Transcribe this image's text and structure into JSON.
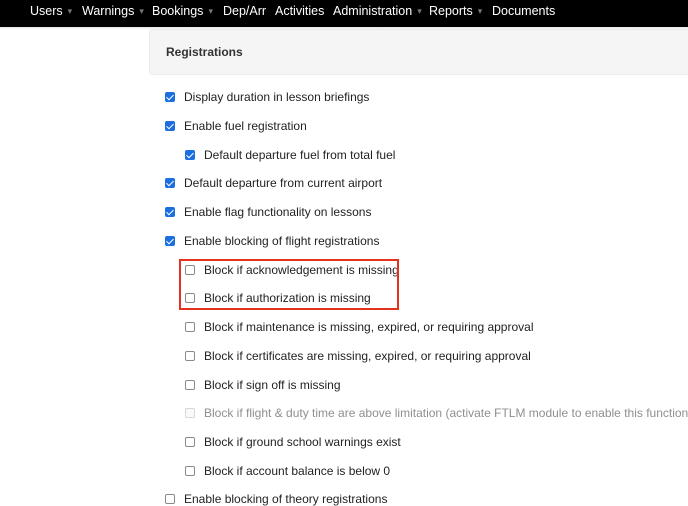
{
  "nav": {
    "items": [
      {
        "label": "Users",
        "dropdown": true
      },
      {
        "label": "Warnings",
        "dropdown": true
      },
      {
        "label": "Bookings",
        "dropdown": true
      },
      {
        "label": "Dep/Arr",
        "dropdown": false
      },
      {
        "label": "Activities",
        "dropdown": false
      },
      {
        "label": "Administration",
        "dropdown": true
      },
      {
        "label": "Reports",
        "dropdown": true
      },
      {
        "label": "Documents",
        "dropdown": false
      }
    ],
    "caret_glyph": "▾"
  },
  "panel": {
    "title": "Registrations"
  },
  "options": [
    {
      "label": "Display duration in lesson briefings",
      "state": "checked"
    },
    {
      "label": "Enable fuel registration",
      "state": "checked"
    },
    {
      "label": "Default departure fuel from total fuel",
      "state": "checked"
    },
    {
      "label": "Default departure from current airport",
      "state": "checked"
    },
    {
      "label": "Enable flag functionality on lessons",
      "state": "checked"
    },
    {
      "label": "Enable blocking of flight registrations",
      "state": "checked"
    },
    {
      "label": "Block if acknowledgement is missing",
      "state": "unchecked"
    },
    {
      "label": "Block if authorization is missing",
      "state": "unchecked"
    },
    {
      "label": "Block if maintenance is missing, expired, or requiring approval",
      "state": "unchecked"
    },
    {
      "label": "Block if certificates are missing, expired, or requiring approval",
      "state": "unchecked"
    },
    {
      "label": "Block if sign off is missing",
      "state": "unchecked"
    },
    {
      "label": "Block if flight & duty time are above limitation (activate FTLM module to enable this function)",
      "state": "disabled"
    },
    {
      "label": "Block if ground school warnings exist",
      "state": "unchecked"
    },
    {
      "label": "Block if account balance is below 0",
      "state": "unchecked"
    },
    {
      "label": "Enable blocking of theory registrations",
      "state": "unchecked"
    }
  ],
  "annotation": {
    "color": "#e5321f",
    "target": "highlight-box"
  },
  "colors": {
    "checkbox_checked": "#1b6fe0",
    "navbar": "#000000"
  }
}
